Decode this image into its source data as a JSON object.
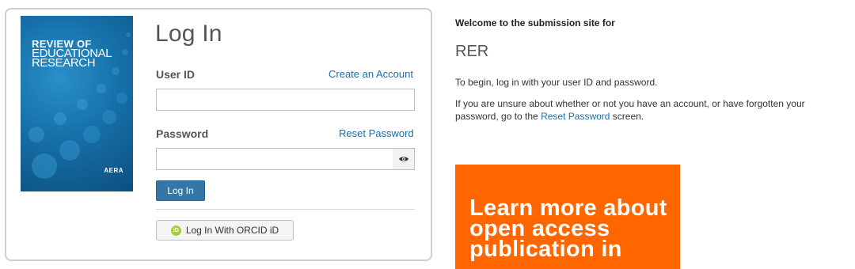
{
  "login": {
    "heading": "Log In",
    "user_id_label": "User ID",
    "create_account_link": "Create an Account",
    "user_id_value": "",
    "password_label": "Password",
    "reset_password_link": "Reset Password",
    "password_value": "",
    "login_button": "Log In",
    "orcid_button": "Log In With ORCID iD",
    "orcid_badge": "iD",
    "show_password_icon": "eye-icon"
  },
  "cover": {
    "line1": "REVIEW OF",
    "line2": "EDUCATIONAL",
    "line3": "RESEARCH",
    "publisher": "AERA"
  },
  "welcome": {
    "heading": "Welcome to the submission site for",
    "journal_code": "RER",
    "instruction": "To begin, log in with your user ID and password.",
    "unsure_text_before": "If you are unsure about whether or not you have an account, or have forgotten your password, go to the ",
    "unsure_link": "Reset Password",
    "unsure_text_after": " screen."
  },
  "promo": {
    "text": "Learn more about open access publication in",
    "background": "#ff6600"
  },
  "colors": {
    "link": "#1a6fa8",
    "primary_button": "#3477a6",
    "orcid_green": "#a6ce39"
  }
}
